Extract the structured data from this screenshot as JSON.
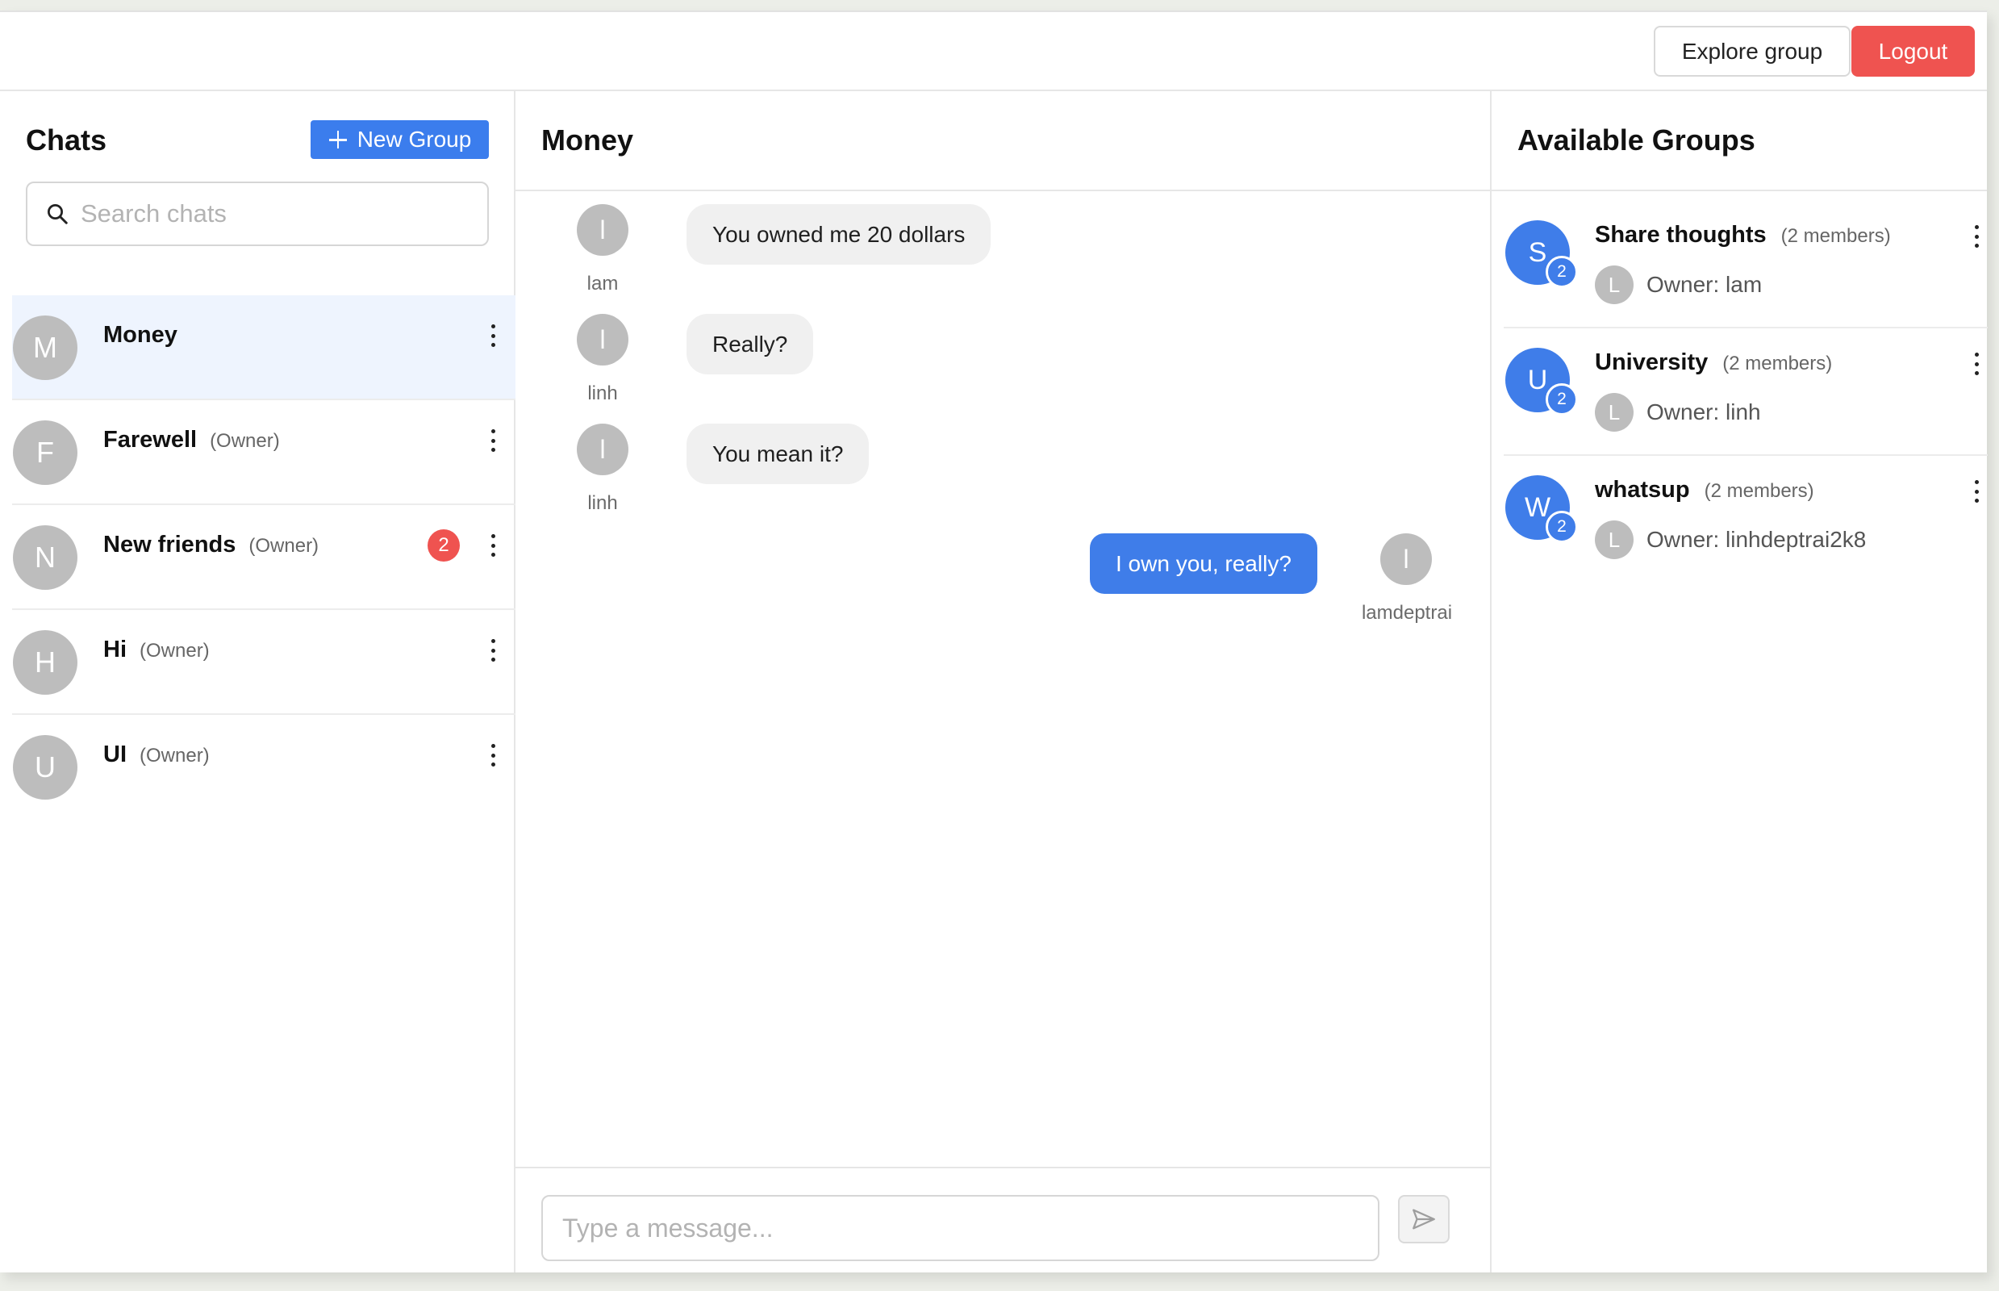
{
  "header": {
    "explore_label": "Explore group",
    "logout_label": "Logout",
    "colors": {
      "logout": "#ef5350",
      "primary": "#3b7ded"
    }
  },
  "sidebar": {
    "title": "Chats",
    "new_group_label": "New Group",
    "search_placeholder": "Search chats",
    "chats": [
      {
        "initial": "M",
        "name": "Money",
        "owner_tag": "",
        "unread": "",
        "active": true
      },
      {
        "initial": "F",
        "name": "Farewell",
        "owner_tag": "(Owner)",
        "unread": ""
      },
      {
        "initial": "N",
        "name": "New friends",
        "owner_tag": "(Owner)",
        "unread": "2"
      },
      {
        "initial": "H",
        "name": "Hi",
        "owner_tag": "(Owner)",
        "unread": ""
      },
      {
        "initial": "U",
        "name": "UI",
        "owner_tag": "(Owner)",
        "unread": ""
      }
    ]
  },
  "conversation": {
    "title": "Money",
    "messages": [
      {
        "initial": "l",
        "sender": "lam",
        "text": "You owned me 20 dollars",
        "direction": "incoming"
      },
      {
        "initial": "l",
        "sender": "linh",
        "text": "Really?",
        "direction": "incoming"
      },
      {
        "initial": "l",
        "sender": "linh",
        "text": "You mean it?",
        "direction": "incoming"
      },
      {
        "initial": "l",
        "sender": "lamdeptrai",
        "text": "I own you, really?",
        "direction": "outgoing"
      }
    ],
    "input_placeholder": "Type a message..."
  },
  "available_groups": {
    "title": "Available Groups",
    "groups": [
      {
        "initial": "S",
        "count": "2",
        "name": "Share thoughts",
        "members": "(2 members)",
        "owner_initial": "L",
        "owner": "Owner: lam"
      },
      {
        "initial": "U",
        "count": "2",
        "name": "University",
        "members": "(2 members)",
        "owner_initial": "L",
        "owner": "Owner: linh"
      },
      {
        "initial": "W",
        "count": "2",
        "name": "whatsup",
        "members": "(2 members)",
        "owner_initial": "L",
        "owner": "Owner: linhdeptrai2k8"
      }
    ]
  }
}
